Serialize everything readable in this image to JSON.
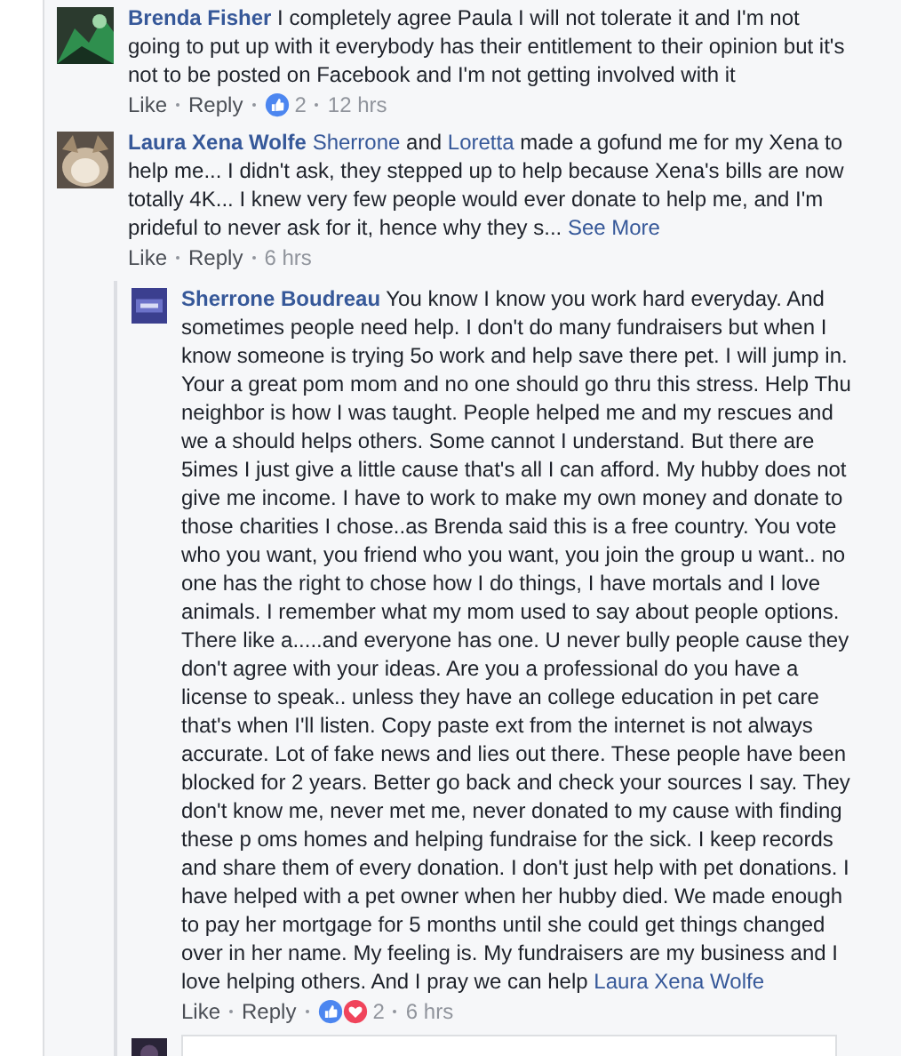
{
  "comments": [
    {
      "author": "Brenda Fisher",
      "body": [
        {
          "kind": "text",
          "text": "I completely agree Paula I will not tolerate it and I'm not going to put up with it everybody has their entitlement to their opinion but it's not to be posted on Facebook and I'm not getting involved with it"
        }
      ],
      "actions": [
        "Like",
        "Reply"
      ],
      "reactions": [
        {
          "kind": "like"
        }
      ],
      "reaction_count": "2",
      "time": "12 hrs"
    },
    {
      "author": "Laura Xena Wolfe",
      "body": [
        {
          "kind": "mention",
          "text": "Sherrone"
        },
        {
          "kind": "text",
          "text": " and "
        },
        {
          "kind": "mention",
          "text": "Loretta"
        },
        {
          "kind": "text",
          "text": " made a gofund me for my Xena to help me... I didn't ask, they stepped up to help because Xena's bills are now totally 4K... I knew very few people would ever donate to help me, and I'm prideful to never ask for it, hence why they s... "
        },
        {
          "kind": "more",
          "text": "See More"
        }
      ],
      "actions": [
        "Like",
        "Reply"
      ],
      "time": "6 hrs",
      "replies": [
        {
          "author": "Sherrone Boudreau",
          "body": [
            {
              "kind": "text",
              "text": "You know I know you work hard everyday. And sometimes people need help. I don't do many fundraisers but when I know someone is trying 5o work and help save there pet. I will jump in. Your a great pom mom and no one should go thru this stress. Help Thu neighbor is how I was taught. People helped me and my rescues and we a should helps others. Some cannot I understand. But there are 5imes I just give a little cause that's all I can afford. My hubby does not give me income. I have to work to make my own money and donate to those charities I chose..as Brenda said this is a free country. You vote who you want, you friend who you want, you join the group u want.. no one has the right to chose how I do things, I have mortals and I love animals. I remember what my mom used to say about people options. There like a.....and everyone has one. U never bully people cause they don't agree with your ideas. Are you a professional do you have a license to speak.. unless they have an college education in pet care that's when I'll listen. Copy paste ext from the internet is not always accurate. Lot of fake news and lies out there. These people have been blocked for 2 years. Better go back and check your sources I say. They don't know me, never met me, never donated to my cause with finding these p oms homes and helping fundraise for the sick. I keep records and share them of every donation. I don't just help with pet donations. I have helped with a pet owner when her hubby died. We made enough to pay her mortgage for 5 months until she could get things changed over in her name. My feeling is. My fundraisers are my business and I love helping others. And I pray we can help "
            },
            {
              "kind": "mention",
              "text": "Laura Xena Wolfe"
            }
          ],
          "actions": [
            "Like",
            "Reply"
          ],
          "reactions": [
            {
              "kind": "like"
            },
            {
              "kind": "love"
            }
          ],
          "reaction_count": "2",
          "time": "6 hrs"
        }
      ]
    }
  ]
}
